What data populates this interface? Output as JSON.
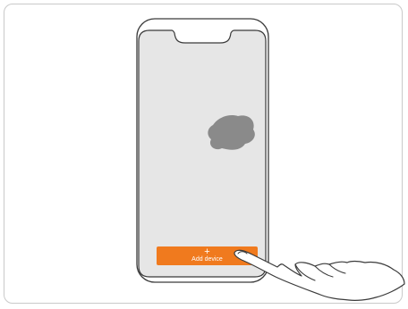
{
  "illustration": {
    "add_device": {
      "plus_glyph": "+",
      "label": "Add device"
    },
    "icons": {
      "blob": "device-placeholder-blob",
      "hand": "pointing-hand"
    },
    "colors": {
      "accent": "#f07a1e",
      "screen": "#e6e6e6",
      "outline": "#3a3a3a",
      "blob": "#8a8a8a"
    }
  }
}
